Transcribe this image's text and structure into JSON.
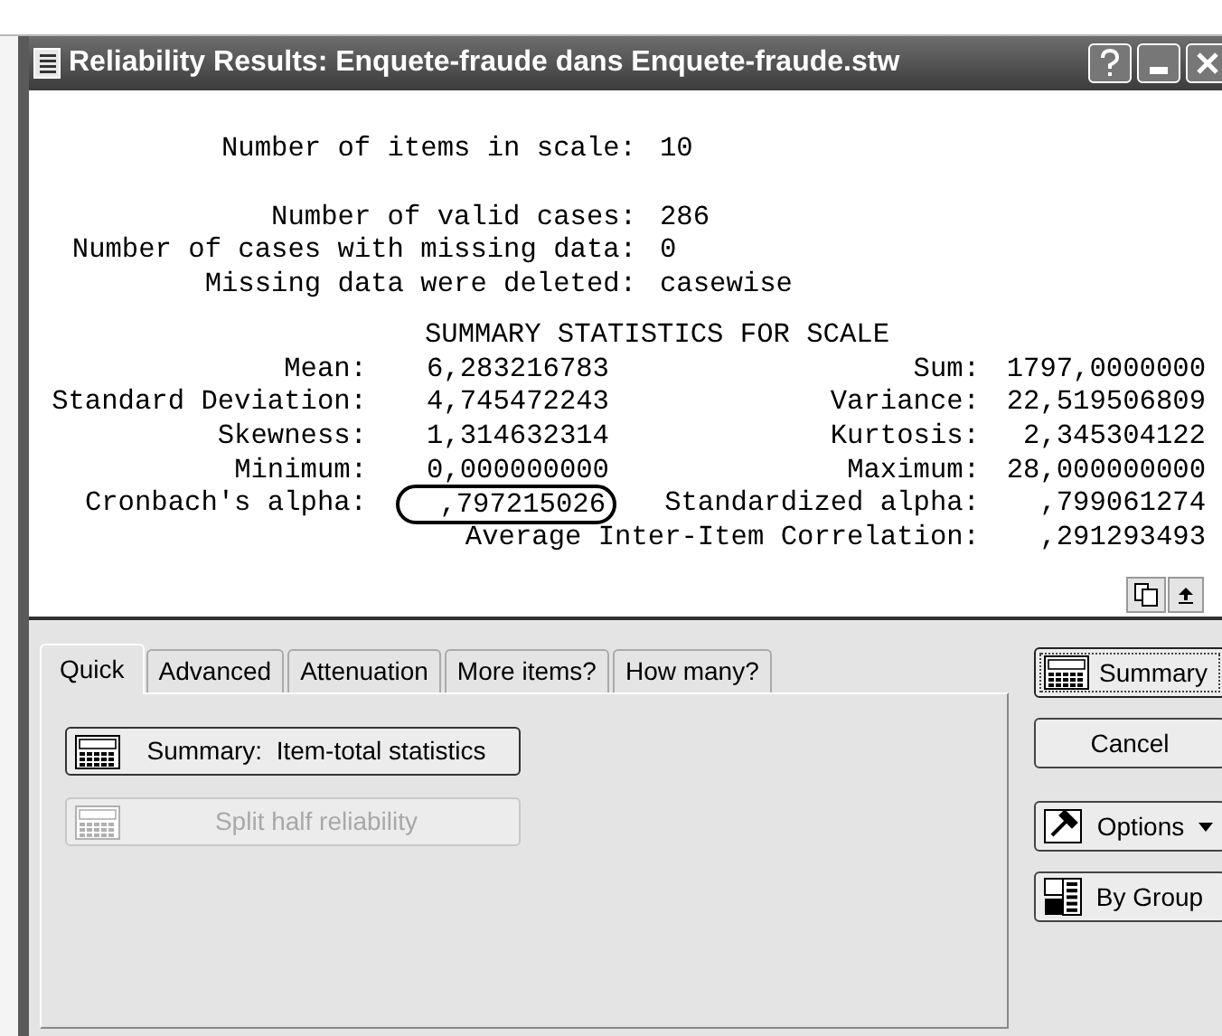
{
  "window": {
    "title": "Reliability Results: Enquete-fraude dans Enquete-fraude.stw"
  },
  "output": {
    "header_groups": [
      [
        {
          "label": "Number of items in scale:",
          "value": "10"
        }
      ],
      [
        {
          "label": "Number of valid cases:",
          "value": "286"
        },
        {
          "label": "Number of cases with missing data:",
          "value": "0"
        },
        {
          "label": "Missing data were deleted:",
          "value": "casewise"
        }
      ]
    ],
    "section_title": "SUMMARY STATISTICS FOR SCALE",
    "stats": [
      {
        "label": "Mean:",
        "value": "6,283216783",
        "circled": false,
        "label2": "Sum:",
        "value2": "1797,0000000"
      },
      {
        "label": "Standard Deviation:",
        "value": "4,745472243",
        "circled": false,
        "label2": "Variance:",
        "value2": "22,519506809"
      },
      {
        "label": "Skewness:",
        "value": "1,314632314",
        "circled": false,
        "label2": "Kurtosis:",
        "value2": "2,345304122"
      },
      {
        "label": "Minimum:",
        "value": "0,000000000",
        "circled": false,
        "label2": "Maximum:",
        "value2": "28,000000000"
      },
      {
        "label": "Cronbach's alpha:",
        "value": ",797215026",
        "circled": true,
        "label2": "Standardized alpha:",
        "value2": ",799061274"
      },
      {
        "label2": "Average Inter-Item Correlation:",
        "value2": ",291293493"
      }
    ]
  },
  "tabs": [
    {
      "label": "Quick",
      "selected": true
    },
    {
      "label": "Advanced",
      "selected": false
    },
    {
      "label": "Attenuation",
      "selected": false
    },
    {
      "label": "More items?",
      "selected": false
    },
    {
      "label": "How many?",
      "selected": false
    }
  ],
  "panel_buttons": [
    {
      "label": "Summary:  Item-total statistics",
      "disabled": false
    },
    {
      "label": "Split half reliability",
      "disabled": true
    }
  ],
  "side_buttons": [
    {
      "kind": "summary",
      "label": "Summary",
      "default": true
    },
    {
      "kind": "cancel",
      "label": "Cancel",
      "default": false
    },
    {
      "kind": "options",
      "label": "Options",
      "default": false
    },
    {
      "kind": "bygroup",
      "label": "By Group",
      "default": false
    }
  ]
}
